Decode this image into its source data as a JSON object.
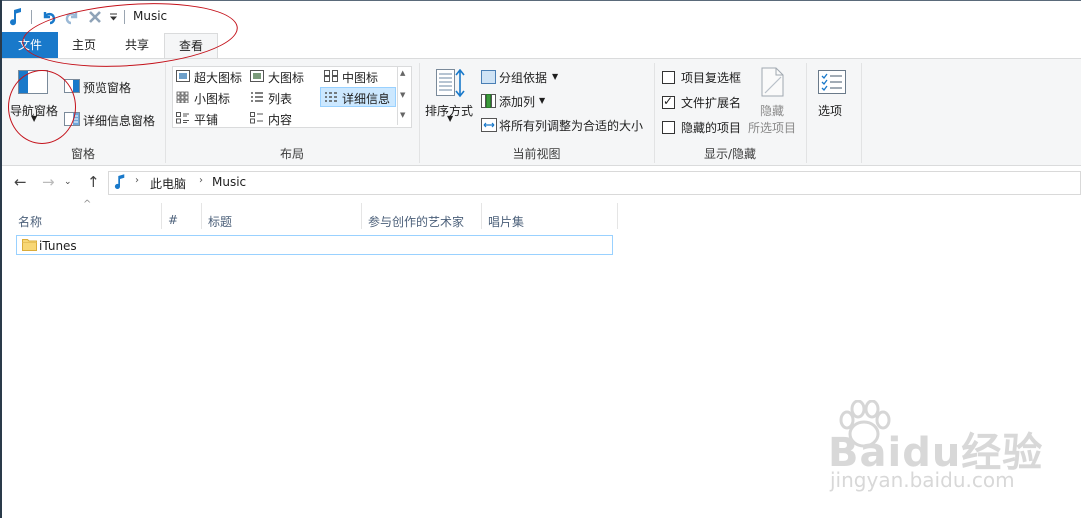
{
  "window": {
    "title": "Music"
  },
  "quick_access": {
    "icons": [
      "music-note-icon",
      "undo-icon",
      "redo-icon",
      "delete-icon",
      "customize-dropdown-icon"
    ]
  },
  "tabs": [
    {
      "label": "文件"
    },
    {
      "label": "主页"
    },
    {
      "label": "共享"
    },
    {
      "label": "查看"
    }
  ],
  "ribbon": {
    "panes": {
      "nav_pane": "导航窗格",
      "preview_pane": "预览窗格",
      "details_pane": "详细信息窗格",
      "group": "窗格"
    },
    "layout": {
      "items": [
        "超大图标",
        "大图标",
        "中图标",
        "小图标",
        "列表",
        "详细信息",
        "平铺",
        "内容"
      ],
      "selected": "详细信息",
      "group": "布局"
    },
    "current_view": {
      "sort_by": "排序方式",
      "group_by": "分组依据",
      "add_columns": "添加列",
      "size_all_columns": "将所有列调整为合适的大小",
      "group": "当前视图"
    },
    "show_hide": {
      "item_checkboxes": {
        "label": "项目复选框",
        "checked": false
      },
      "file_extensions": {
        "label": "文件扩展名",
        "checked": true
      },
      "hidden_items": {
        "label": "隐藏的项目",
        "checked": false
      },
      "hide_selected_1": "隐藏",
      "hide_selected_2": "所选项目",
      "group": "显示/隐藏"
    },
    "options": "选项"
  },
  "address": {
    "crumbs": [
      "此电脑",
      "Music"
    ]
  },
  "columns": [
    "名称",
    "#",
    "标题",
    "参与创作的艺术家",
    "唱片集"
  ],
  "files": [
    {
      "name": "iTunes",
      "type": "folder"
    }
  ],
  "watermark": {
    "brand": "Baidu经验",
    "url": "jingyan.baidu.com"
  },
  "colors": {
    "accent": "#1979ca",
    "ribbon_bg": "#f5f6f7",
    "selection": "#cce8ff",
    "annotation": "#c4121b"
  }
}
